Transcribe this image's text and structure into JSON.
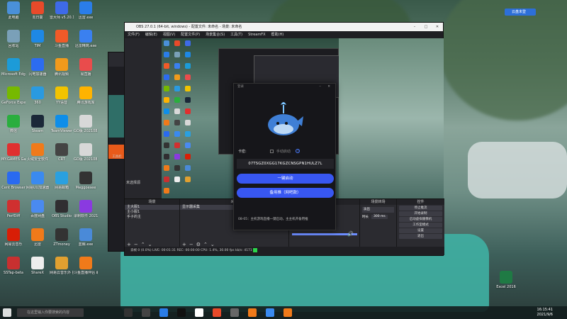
{
  "desktop_icons": [
    {
      "name": "此电脑",
      "color": "#4a90d9"
    },
    {
      "name": "向日葵",
      "color": "#e84a2a"
    },
    {
      "name": "雷大师\nv5.20.121...",
      "color": "#3e6ae8"
    },
    {
      "name": "迅雷.exe",
      "color": "#2a7de8"
    },
    {
      "name": "回收站",
      "color": "#7aa0b8"
    },
    {
      "name": "TIM",
      "color": "#1e88e5"
    },
    {
      "name": "斗鱼直播",
      "color": "#f05a28"
    },
    {
      "name": "迅雷精简.exe",
      "color": "#3a80f0"
    },
    {
      "name": "Microsoft Edge",
      "color": "#1c9bd8"
    },
    {
      "name": "闪电加速器",
      "color": "#2c6cf0"
    },
    {
      "name": "腾讯视频",
      "color": "#f09a1c"
    },
    {
      "name": "易直播",
      "color": "#e94c4c"
    },
    {
      "name": "GeForce Experience",
      "color": "#76b900"
    },
    {
      "name": "360",
      "color": "#2a9ae0"
    },
    {
      "name": "YY语音",
      "color": "#f2c300"
    },
    {
      "name": "腾讯游戏库",
      "color": "#ffb300"
    },
    {
      "name": "微信",
      "color": "#2aae3e"
    },
    {
      "name": "Steam",
      "color": "#1b2838"
    },
    {
      "name": "TeamViewer",
      "color": "#0e8ee9"
    },
    {
      "name": "GO版\n2021083...",
      "color": "#d8d8d8"
    },
    {
      "name": "MY.GAMES GameCenter",
      "color": "#e03030"
    },
    {
      "name": "火绒安全软件",
      "color": "#f07a1a"
    },
    {
      "name": "CRT",
      "color": "#444"
    },
    {
      "name": "GO版\n2021083...",
      "color": "#d8d8d8"
    },
    {
      "name": "Cent Browser",
      "color": "#2a6af0"
    },
    {
      "name": "网易UU加速器",
      "color": "#3a8af0"
    },
    {
      "name": "网易邮箱",
      "color": "#2aa0e0"
    },
    {
      "name": "Meggoesee",
      "color": "#333"
    },
    {
      "name": "PerfDiff",
      "color": "#d03030"
    },
    {
      "name": "百度网盘",
      "color": "#4a8af0"
    },
    {
      "name": "OBS Studio",
      "color": "#302e31"
    },
    {
      "name": "录制软件\n2021...",
      "color": "#8a3ae0"
    },
    {
      "name": "网易云音乐",
      "color": "#d81e06"
    },
    {
      "name": "迅雷",
      "color": "#f07a1a"
    },
    {
      "name": "ZTmoney",
      "color": "#333"
    },
    {
      "name": "蓝鲸.exe",
      "color": "#4a8ad8"
    },
    {
      "name": "SSTap-beta",
      "color": "#c83030"
    },
    {
      "name": "ShareX",
      "color": "#eee"
    },
    {
      "name": "网易云音乐外\n挂工具",
      "color": "#e0a030"
    },
    {
      "name": "斗鱼直播伴侣\n助手",
      "color": "#f07a1a"
    }
  ],
  "obs": {
    "title": "OBS 27.0.1 (64-bit, windows) - 配置文件: 未命名 - 场景: 未命名",
    "menu": [
      "文件(F)",
      "编辑(E)",
      "视图(V)",
      "配置文件(P)",
      "场景集合(S)",
      "工具(T)",
      "StreamFX",
      "帮助(H)"
    ],
    "docks": {
      "scenes_title": "场景",
      "scenes": [
        "主大服1",
        "主小服1",
        "手子的主"
      ],
      "sources_title": "来源",
      "sources": [
        "显示器采集"
      ],
      "mixer_title": "音频混音器",
      "transitions_title": "场景转场",
      "transition_value": "淡出",
      "transition_duration_label": "时长",
      "transition_duration": "300 ms",
      "controls_title": "控件",
      "controls": [
        "停止推流",
        "开始录制",
        "启动虚拟摄像机",
        "工作室模式",
        "设置",
        "退出"
      ]
    },
    "scene_tab": "未选择源",
    "status": "丢帧 0 (0.0%)   LIVE: 00:01:31   REC: 00:00:00   CPU: 1.4%, 30.00 fps   kb/s: 4171",
    "left_label": "工具栏"
  },
  "popup": {
    "title": "登录",
    "key_label": "卡密:",
    "auto_label": "手动启动",
    "key_value": "07TSGZ0XGG17KGZCNSGPN1HULZ7L",
    "primary_button": "一键启动",
    "backup_button": "备用推（网吧款）",
    "note": "08-05：主机游戏直播一键启动，主主机开备用推"
  },
  "taskbar": {
    "search_placeholder": "在这里输入你要搜索的内容",
    "time": "16:15:41",
    "date": "2021/9/6"
  },
  "topright_badge": "云盘未登",
  "recycle_label": "Excel 2016"
}
